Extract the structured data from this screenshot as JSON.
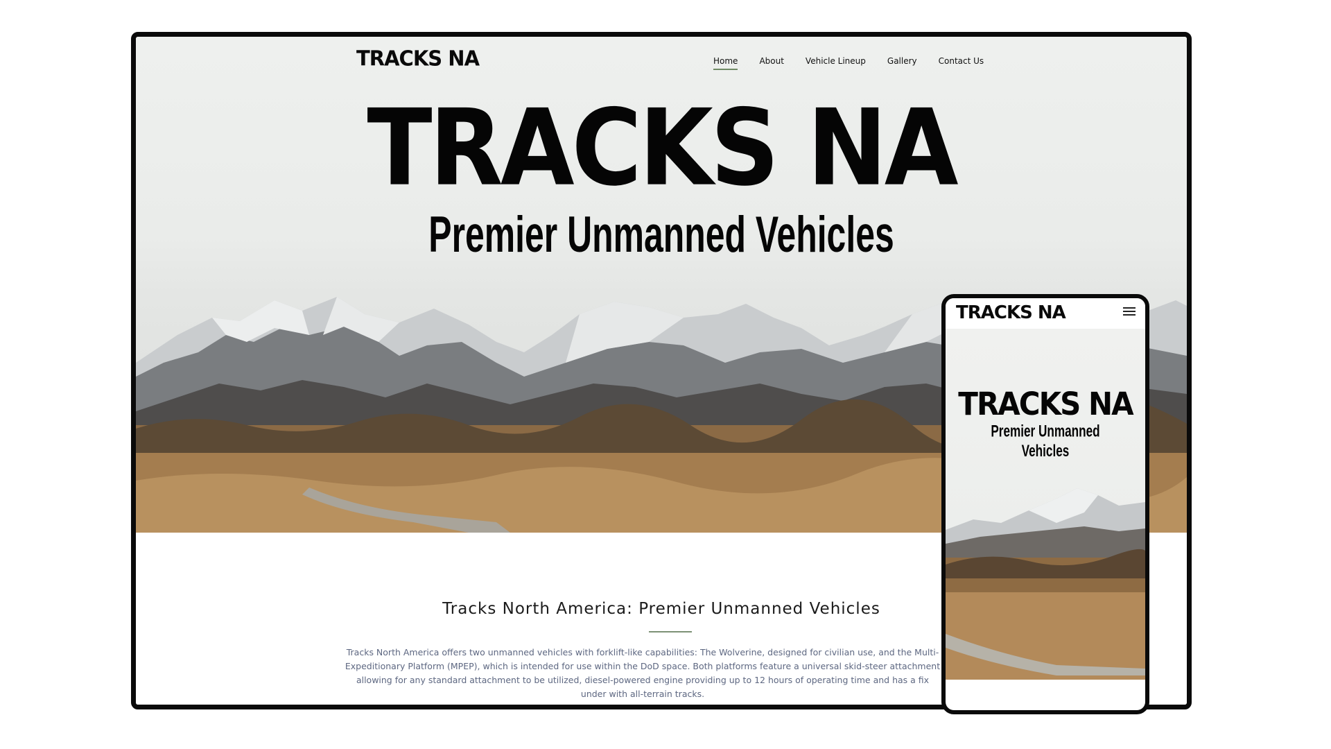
{
  "site": {
    "logo": "TRACKS NA"
  },
  "nav": {
    "items": [
      {
        "label": "Home",
        "active": true
      },
      {
        "label": "About"
      },
      {
        "label": "Vehicle Lineup"
      },
      {
        "label": "Gallery"
      },
      {
        "label": "Contact Us"
      }
    ]
  },
  "hero": {
    "title": "TRACKS NA",
    "subtitle": "Premier Unmanned Vehicles"
  },
  "content": {
    "heading": "Tracks North America: Premier Unmanned Vehicles",
    "body": "Tracks North America offers two unmanned vehicles with forklift-like capabilities: The Wolverine, designed for civilian use, and the Multi-Expeditionary Platform (MPEP), which is intended for use within the DoD space. Both platforms feature a universal skid-steer attachment allowing for any standard attachment to be utilized, diesel-powered engine providing up to 12 hours of operating time and has a fix under with all-terrain tracks."
  },
  "mobile": {
    "logo": "TRACKS NA",
    "menu_icon": "hamburger-icon",
    "title": "TRACKS NA",
    "subtitle": "Premier Unmanned Vehicles"
  },
  "colors": {
    "accent": "#6f8a64",
    "text_dark": "#050505",
    "body_text": "#5d6781"
  }
}
